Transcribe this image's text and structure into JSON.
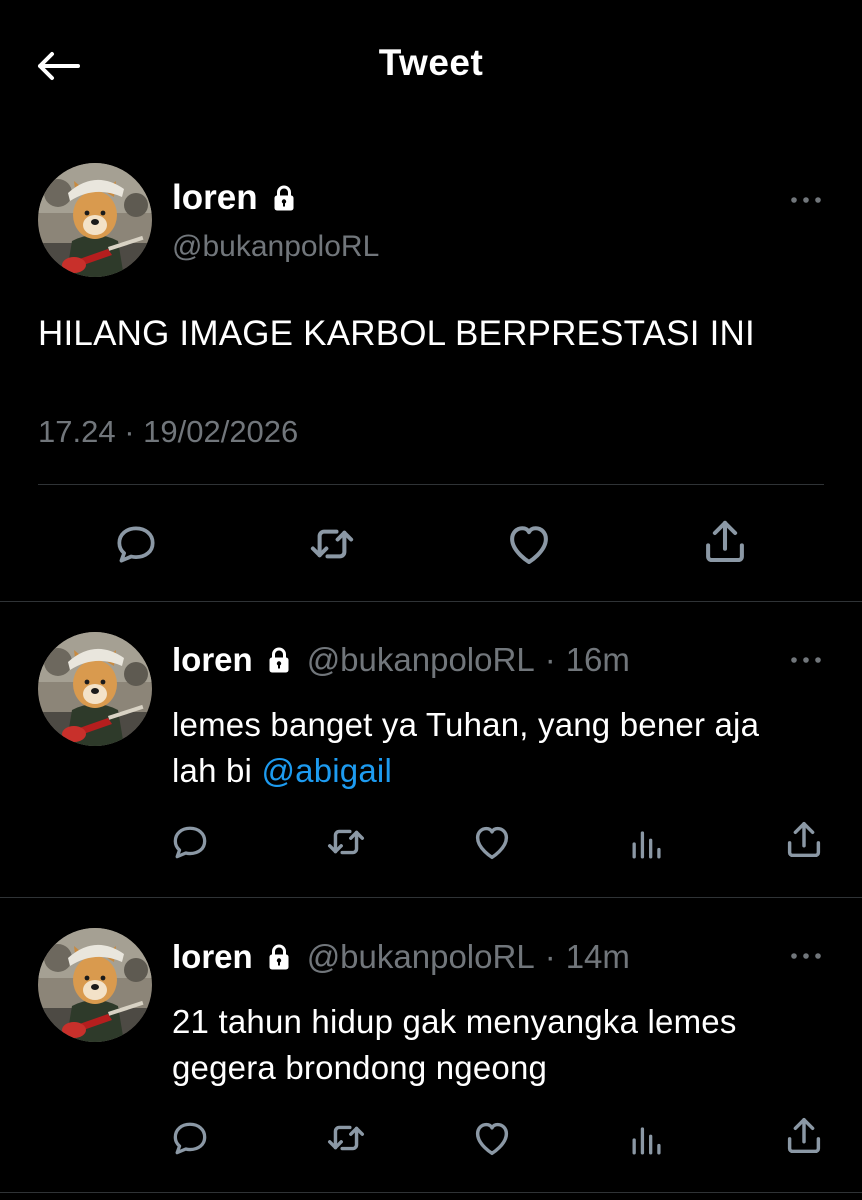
{
  "header": {
    "title": "Tweet",
    "back_icon": "arrow-left-icon"
  },
  "colors": {
    "background": "#000000",
    "text": "#ffffff",
    "secondary": "#71767b",
    "link": "#1d9bf0",
    "divider": "#2f3336"
  },
  "main_tweet": {
    "name": "loren",
    "handle": "@bukanpoloRL",
    "text": "HILANG IMAGE KARBOL BERPRESTASI INI",
    "timestamp": "17.24 · 19/02/2026",
    "actions": [
      "reply-icon",
      "retweet-icon",
      "like-icon",
      "share-icon"
    ]
  },
  "replies": [
    {
      "name": "loren",
      "handle": "@bukanpoloRL",
      "dot": "·",
      "time": "16m",
      "text_before": "lemes banget ya Tuhan, yang bener aja",
      "text_line2": "lah bi ",
      "mention": "@abigail",
      "actions": [
        "reply-icon",
        "retweet-icon",
        "like-icon",
        "views-icon",
        "share-icon"
      ]
    },
    {
      "name": "loren",
      "handle": "@bukanpoloRL",
      "dot": "·",
      "time": "14m",
      "text_line1": "21 tahun hidup gak menyangka lemes",
      "text_line2": "gegera brondong ngeong",
      "actions": [
        "reply-icon",
        "retweet-icon",
        "like-icon",
        "views-icon",
        "share-icon"
      ]
    }
  ]
}
